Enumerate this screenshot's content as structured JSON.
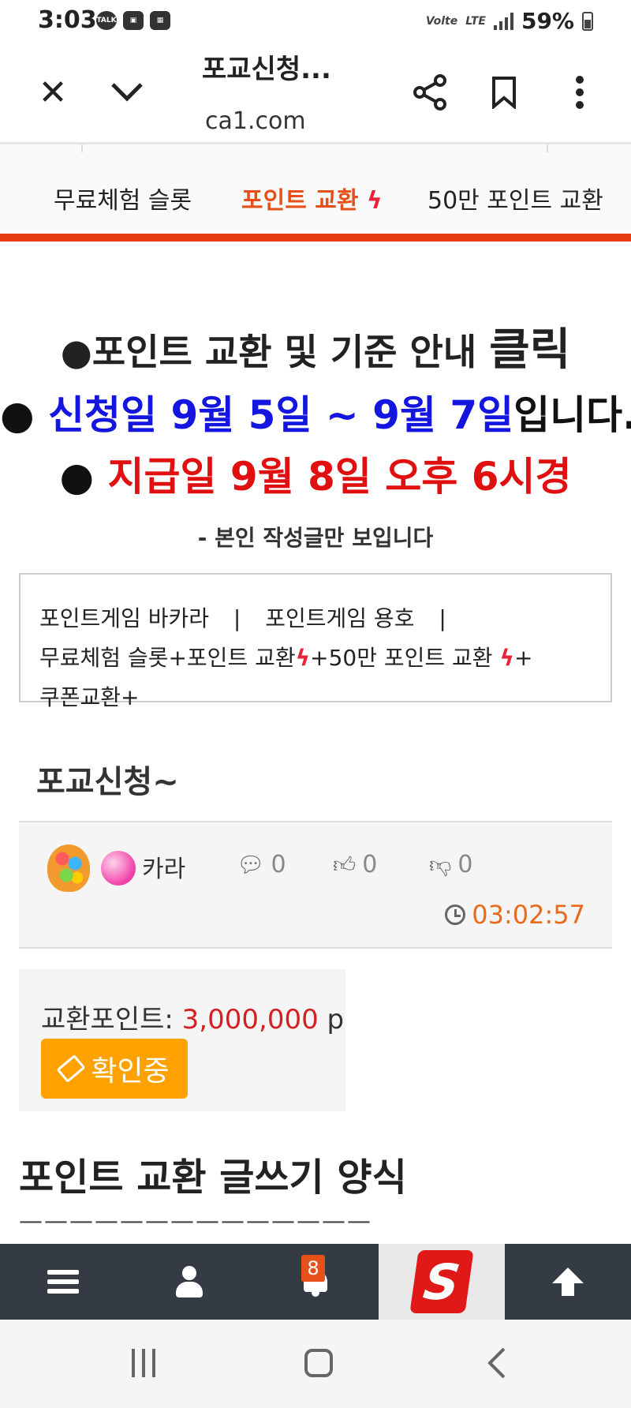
{
  "status_bar": {
    "time": "3:03",
    "icons_left": [
      "talk-icon",
      "image-icon",
      "calendar-icon"
    ],
    "network_label": "Volte",
    "lte_label": "LTE",
    "battery": "59%"
  },
  "browser": {
    "title": "포교신청...",
    "url": "ca1.com"
  },
  "category_nav": {
    "items": [
      "무료체험 슬롯",
      "포인트 교환",
      "50만 포인트 교환"
    ],
    "active_index": 1,
    "active_color": "#e8501a",
    "underline_color": "#e63e10"
  },
  "notices": {
    "line1_prefix": "●포인트 교환 및 기준 안내 ",
    "line1_link": "클릭",
    "line2_bullet": "● ",
    "line2_highlight": "신청일 9월 5일 ~ 9월 7일",
    "line2_suffix": "입니다.",
    "line3_bullet": "● ",
    "line3_text": "지급일 9월 8일 오후 6시경",
    "line4": "- 본인 작성글만 보입니다"
  },
  "category_box": {
    "row1": [
      "포인트게임 바카라",
      "포인트게임 용호"
    ],
    "row2_a": "무료체험 슬롯+포인트 교환",
    "row2_b": "+50만 포인트 교환",
    "row2_c": "+",
    "row3": "쿠폰교환+",
    "separator": "|",
    "bolt": "ϟ"
  },
  "post": {
    "title": "포교신청~",
    "author": "카라",
    "comments": "0",
    "likes": "0",
    "dislikes": "0",
    "time": "03:02:57"
  },
  "exchange": {
    "label": "교환포인트: ",
    "value": "3,000,000",
    "unit": " p",
    "status_label": "확인중",
    "status_color": "#ffa200"
  },
  "form": {
    "heading": "포인트 교환 글쓰기 양식",
    "dashes": "——————————————"
  },
  "bottom_nav": {
    "notification_count": "8",
    "logo_letter": "S"
  }
}
